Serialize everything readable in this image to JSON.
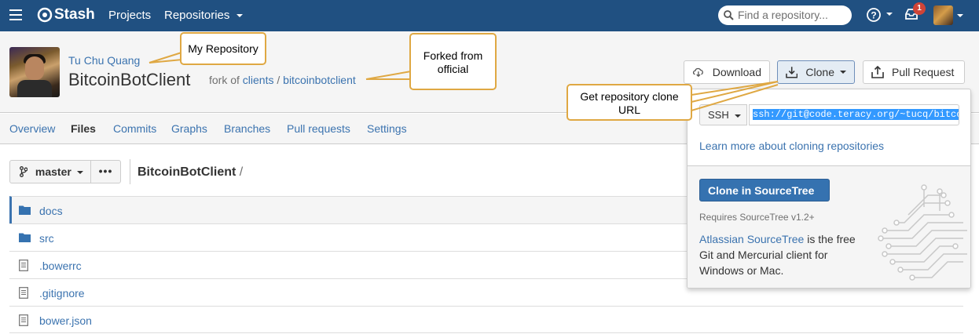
{
  "header": {
    "brand": "Stash",
    "nav_projects": "Projects",
    "nav_repositories": "Repositories",
    "search_placeholder": "Find a repository...",
    "notification_count": "1"
  },
  "repo": {
    "owner": "Tu Chu Quang",
    "name": "BitcoinBotClient",
    "fork_prefix": "fork of",
    "fork_project": "clients",
    "fork_separator": "/",
    "fork_repo": "bitcoinbotclient"
  },
  "actions": {
    "download": "Download",
    "clone": "Clone",
    "pull_request": "Pull Request"
  },
  "tabs": [
    {
      "label": "Overview"
    },
    {
      "label": "Files"
    },
    {
      "label": "Commits"
    },
    {
      "label": "Graphs"
    },
    {
      "label": "Branches"
    },
    {
      "label": "Pull requests"
    },
    {
      "label": "Settings"
    }
  ],
  "files": {
    "branch": "master",
    "more": "•••",
    "breadcrumb": "BitcoinBotClient",
    "breadcrumb_sep": "/",
    "items": [
      {
        "name": "docs",
        "type": "folder"
      },
      {
        "name": "src",
        "type": "folder"
      },
      {
        "name": ".bowerrc",
        "type": "file"
      },
      {
        "name": ".gitignore",
        "type": "file"
      },
      {
        "name": "bower.json",
        "type": "file"
      }
    ]
  },
  "clone_dialog": {
    "protocol": "SSH",
    "url": "ssh://git@code.teracy.org/~tucq/bitco",
    "learn_more": "Learn more about cloning repositories",
    "sourcetree_button": "Clone in SourceTree",
    "requires": "Requires SourceTree v1.2+",
    "sourcetree_link": "Atlassian SourceTree",
    "sourcetree_desc": " is the free Git and Mercurial client for Windows or Mac."
  },
  "callouts": {
    "my_repository": "My Repository",
    "forked_line1": "Forked from",
    "forked_line2": "official",
    "clone_line1": "Get repository clone",
    "clone_line2": "URL"
  },
  "colors": {
    "header_bg": "#205081",
    "link": "#3b73af",
    "callout_border": "#dfa843",
    "primary_button": "#3572b0"
  }
}
